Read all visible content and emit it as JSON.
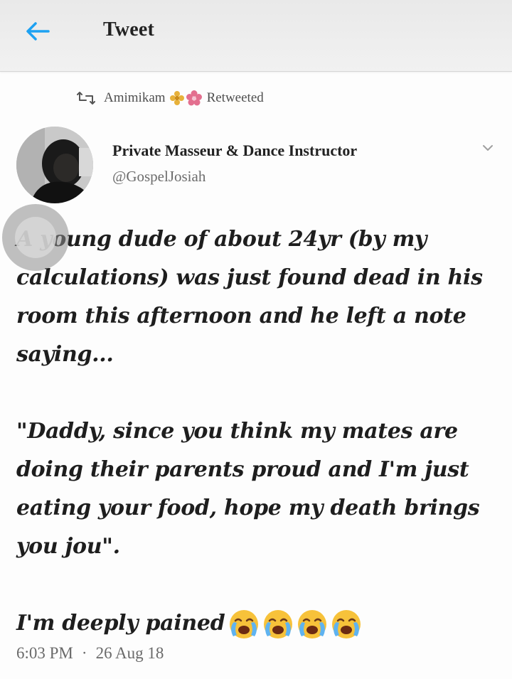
{
  "header": {
    "title": "Tweet",
    "back_icon": "back-arrow-icon",
    "accent": "#1da1f2"
  },
  "retweet": {
    "retweeter": "Amimikam",
    "label": "Retweeted"
  },
  "author": {
    "display_name": "Private Masseur & Dance Instructor",
    "handle": "@GospelJosiah"
  },
  "tweet": {
    "paragraph1": "A young dude of about 24yr (by my calculations) was just found dead in his room this afternoon and he left a note saying...",
    "paragraph2": "\"Daddy, since you think my mates are doing their parents proud and I'm just eating your food, hope my death brings you jou\".",
    "paragraph3": "I'm deeply pained",
    "emoji_name": "loudly-crying-face-icon",
    "emoji_count": 4
  },
  "meta": {
    "time": "6:03 PM",
    "separator": "·",
    "date": "26 Aug 18"
  }
}
